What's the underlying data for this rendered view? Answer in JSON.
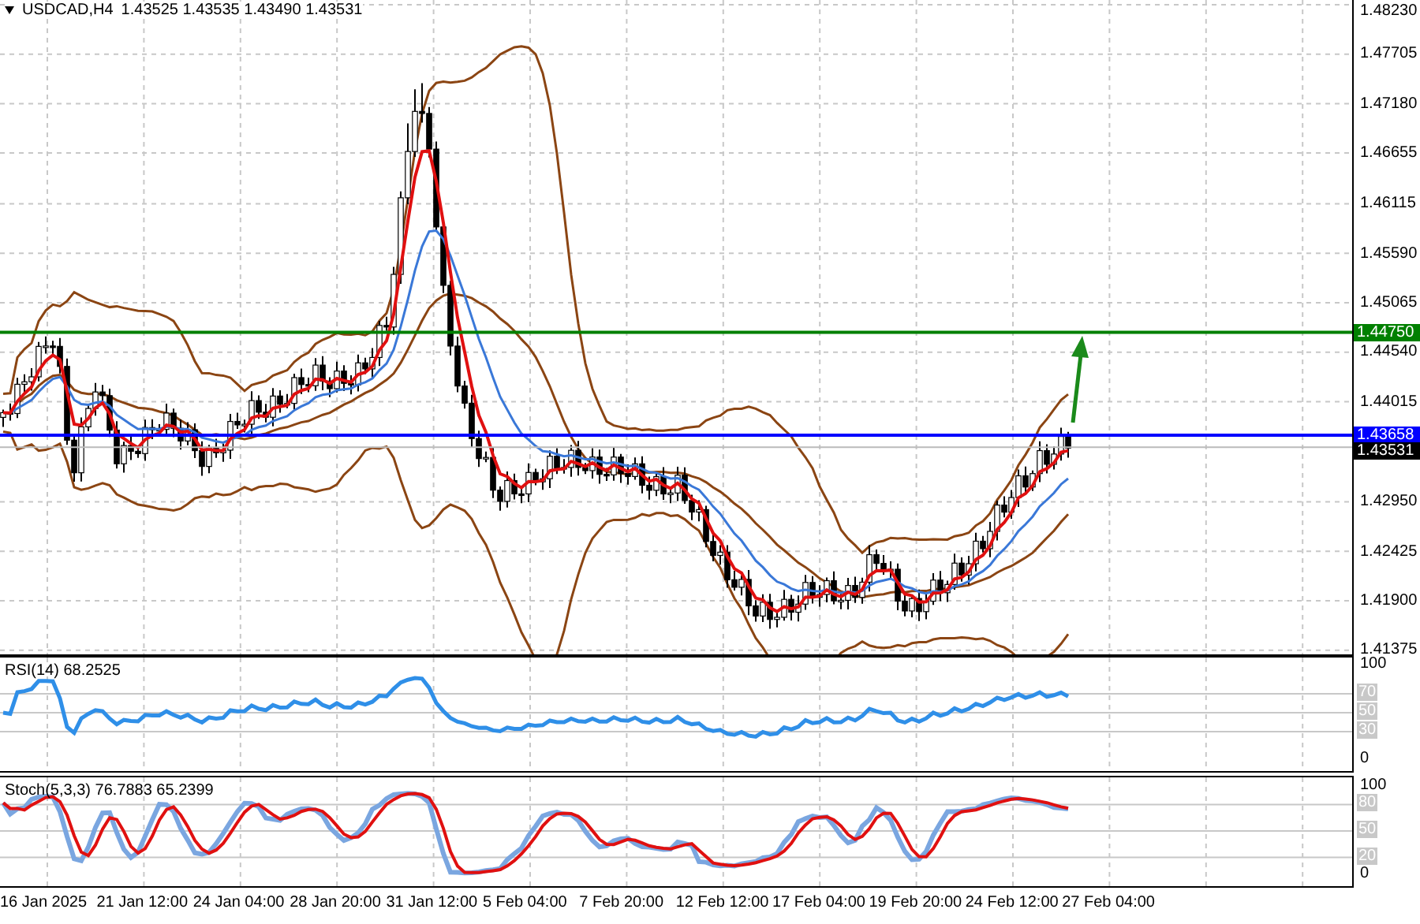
{
  "header": {
    "symbol": "USDCAD,H4",
    "ohlc": "1.43525 1.43535 1.43490 1.43531"
  },
  "price_axis": {
    "ticks": [
      "1.48230",
      "1.47705",
      "1.47180",
      "1.46655",
      "1.46115",
      "1.45590",
      "1.45065",
      "1.44540",
      "1.44015",
      "1.42950",
      "1.42425",
      "1.41900",
      "1.41375"
    ]
  },
  "levels": [
    {
      "label": "1.44750",
      "color": "#008000"
    },
    {
      "label": "1.43658",
      "color": "#0000ff"
    }
  ],
  "current_price": "1.43531",
  "rsi": {
    "label": "RSI(14) 68.2525",
    "ticks": [
      "100",
      "70",
      "50",
      "30",
      "0"
    ]
  },
  "stoch": {
    "label": "Stoch(5,3,3) 76.7883 65.2399",
    "ticks": [
      "100",
      "80",
      "50",
      "20",
      "0"
    ]
  },
  "time_axis": [
    "16 Jan 2025",
    "21 Jan 12:00",
    "24 Jan 04:00",
    "28 Jan 20:00",
    "31 Jan 12:00",
    "5 Feb 04:00",
    "7 Feb 20:00",
    "12 Feb 12:00",
    "17 Feb 04:00",
    "19 Feb 20:00",
    "24 Feb 12:00",
    "27 Feb 04:00"
  ]
}
